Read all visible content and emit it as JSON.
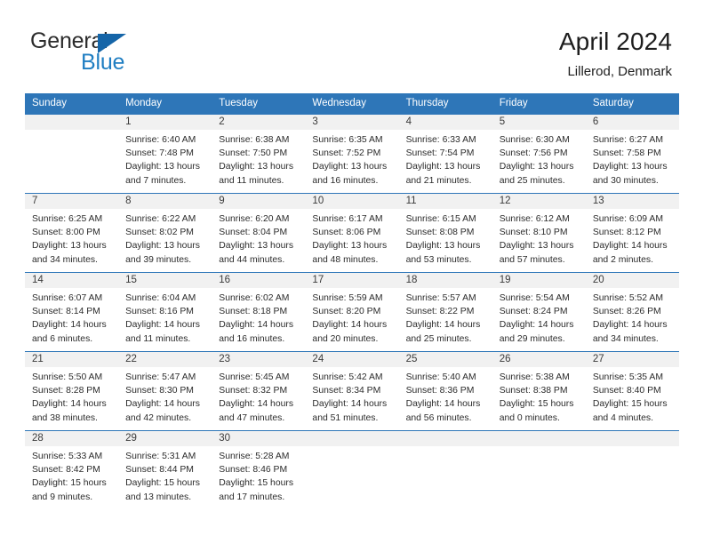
{
  "logo": {
    "word_one": "General",
    "word_two": "Blue",
    "triangle_color": "#1565a8",
    "blue_text_color": "#1f7ec2",
    "icon": "triangle-icon"
  },
  "header": {
    "title": "April 2024",
    "subtitle": "Lillerod, Denmark"
  },
  "colors": {
    "header_blue": "#2e76b8",
    "daynum_band": "#f1f1f1",
    "text": "#2b2b2b"
  },
  "weekday_headers": [
    "Sunday",
    "Monday",
    "Tuesday",
    "Wednesday",
    "Thursday",
    "Friday",
    "Saturday"
  ],
  "labels": {
    "sunrise_prefix": "Sunrise:",
    "sunset_prefix": "Sunset:",
    "daylight_prefix": "Daylight:"
  },
  "weeks": [
    [
      {
        "day": "",
        "empty": true
      },
      {
        "day": "1",
        "line1": "Sunrise: 6:40 AM",
        "line2": "Sunset: 7:48 PM",
        "line3": "Daylight: 13 hours",
        "line4": "and 7 minutes."
      },
      {
        "day": "2",
        "line1": "Sunrise: 6:38 AM",
        "line2": "Sunset: 7:50 PM",
        "line3": "Daylight: 13 hours",
        "line4": "and 11 minutes."
      },
      {
        "day": "3",
        "line1": "Sunrise: 6:35 AM",
        "line2": "Sunset: 7:52 PM",
        "line3": "Daylight: 13 hours",
        "line4": "and 16 minutes."
      },
      {
        "day": "4",
        "line1": "Sunrise: 6:33 AM",
        "line2": "Sunset: 7:54 PM",
        "line3": "Daylight: 13 hours",
        "line4": "and 21 minutes."
      },
      {
        "day": "5",
        "line1": "Sunrise: 6:30 AM",
        "line2": "Sunset: 7:56 PM",
        "line3": "Daylight: 13 hours",
        "line4": "and 25 minutes."
      },
      {
        "day": "6",
        "line1": "Sunrise: 6:27 AM",
        "line2": "Sunset: 7:58 PM",
        "line3": "Daylight: 13 hours",
        "line4": "and 30 minutes."
      }
    ],
    [
      {
        "day": "7",
        "line1": "Sunrise: 6:25 AM",
        "line2": "Sunset: 8:00 PM",
        "line3": "Daylight: 13 hours",
        "line4": "and 34 minutes."
      },
      {
        "day": "8",
        "line1": "Sunrise: 6:22 AM",
        "line2": "Sunset: 8:02 PM",
        "line3": "Daylight: 13 hours",
        "line4": "and 39 minutes."
      },
      {
        "day": "9",
        "line1": "Sunrise: 6:20 AM",
        "line2": "Sunset: 8:04 PM",
        "line3": "Daylight: 13 hours",
        "line4": "and 44 minutes."
      },
      {
        "day": "10",
        "line1": "Sunrise: 6:17 AM",
        "line2": "Sunset: 8:06 PM",
        "line3": "Daylight: 13 hours",
        "line4": "and 48 minutes."
      },
      {
        "day": "11",
        "line1": "Sunrise: 6:15 AM",
        "line2": "Sunset: 8:08 PM",
        "line3": "Daylight: 13 hours",
        "line4": "and 53 minutes."
      },
      {
        "day": "12",
        "line1": "Sunrise: 6:12 AM",
        "line2": "Sunset: 8:10 PM",
        "line3": "Daylight: 13 hours",
        "line4": "and 57 minutes."
      },
      {
        "day": "13",
        "line1": "Sunrise: 6:09 AM",
        "line2": "Sunset: 8:12 PM",
        "line3": "Daylight: 14 hours",
        "line4": "and 2 minutes."
      }
    ],
    [
      {
        "day": "14",
        "line1": "Sunrise: 6:07 AM",
        "line2": "Sunset: 8:14 PM",
        "line3": "Daylight: 14 hours",
        "line4": "and 6 minutes."
      },
      {
        "day": "15",
        "line1": "Sunrise: 6:04 AM",
        "line2": "Sunset: 8:16 PM",
        "line3": "Daylight: 14 hours",
        "line4": "and 11 minutes."
      },
      {
        "day": "16",
        "line1": "Sunrise: 6:02 AM",
        "line2": "Sunset: 8:18 PM",
        "line3": "Daylight: 14 hours",
        "line4": "and 16 minutes."
      },
      {
        "day": "17",
        "line1": "Sunrise: 5:59 AM",
        "line2": "Sunset: 8:20 PM",
        "line3": "Daylight: 14 hours",
        "line4": "and 20 minutes."
      },
      {
        "day": "18",
        "line1": "Sunrise: 5:57 AM",
        "line2": "Sunset: 8:22 PM",
        "line3": "Daylight: 14 hours",
        "line4": "and 25 minutes."
      },
      {
        "day": "19",
        "line1": "Sunrise: 5:54 AM",
        "line2": "Sunset: 8:24 PM",
        "line3": "Daylight: 14 hours",
        "line4": "and 29 minutes."
      },
      {
        "day": "20",
        "line1": "Sunrise: 5:52 AM",
        "line2": "Sunset: 8:26 PM",
        "line3": "Daylight: 14 hours",
        "line4": "and 34 minutes."
      }
    ],
    [
      {
        "day": "21",
        "line1": "Sunrise: 5:50 AM",
        "line2": "Sunset: 8:28 PM",
        "line3": "Daylight: 14 hours",
        "line4": "and 38 minutes."
      },
      {
        "day": "22",
        "line1": "Sunrise: 5:47 AM",
        "line2": "Sunset: 8:30 PM",
        "line3": "Daylight: 14 hours",
        "line4": "and 42 minutes."
      },
      {
        "day": "23",
        "line1": "Sunrise: 5:45 AM",
        "line2": "Sunset: 8:32 PM",
        "line3": "Daylight: 14 hours",
        "line4": "and 47 minutes."
      },
      {
        "day": "24",
        "line1": "Sunrise: 5:42 AM",
        "line2": "Sunset: 8:34 PM",
        "line3": "Daylight: 14 hours",
        "line4": "and 51 minutes."
      },
      {
        "day": "25",
        "line1": "Sunrise: 5:40 AM",
        "line2": "Sunset: 8:36 PM",
        "line3": "Daylight: 14 hours",
        "line4": "and 56 minutes."
      },
      {
        "day": "26",
        "line1": "Sunrise: 5:38 AM",
        "line2": "Sunset: 8:38 PM",
        "line3": "Daylight: 15 hours",
        "line4": "and 0 minutes."
      },
      {
        "day": "27",
        "line1": "Sunrise: 5:35 AM",
        "line2": "Sunset: 8:40 PM",
        "line3": "Daylight: 15 hours",
        "line4": "and 4 minutes."
      }
    ],
    [
      {
        "day": "28",
        "line1": "Sunrise: 5:33 AM",
        "line2": "Sunset: 8:42 PM",
        "line3": "Daylight: 15 hours",
        "line4": "and 9 minutes."
      },
      {
        "day": "29",
        "line1": "Sunrise: 5:31 AM",
        "line2": "Sunset: 8:44 PM",
        "line3": "Daylight: 15 hours",
        "line4": "and 13 minutes."
      },
      {
        "day": "30",
        "line1": "Sunrise: 5:28 AM",
        "line2": "Sunset: 8:46 PM",
        "line3": "Daylight: 15 hours",
        "line4": "and 17 minutes."
      },
      {
        "day": "",
        "empty": true
      },
      {
        "day": "",
        "empty": true
      },
      {
        "day": "",
        "empty": true
      },
      {
        "day": "",
        "empty": true
      }
    ]
  ]
}
